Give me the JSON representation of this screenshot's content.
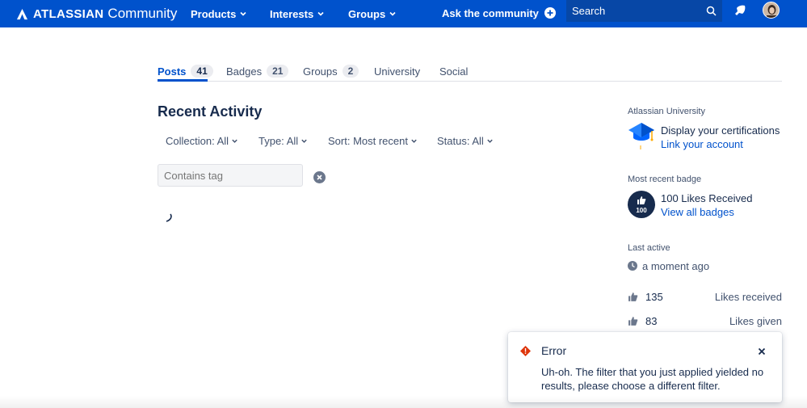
{
  "nav": {
    "brand_bold": "ATLASSIAN",
    "brand_light": "Community",
    "items": [
      {
        "label": "Products"
      },
      {
        "label": "Interests"
      },
      {
        "label": "Groups"
      }
    ],
    "ask_label": "Ask the community",
    "search_placeholder": "Search"
  },
  "tabs": [
    {
      "label": "Posts",
      "count": "41"
    },
    {
      "label": "Badges",
      "count": "21"
    },
    {
      "label": "Groups",
      "count": "2"
    },
    {
      "label": "University"
    },
    {
      "label": "Social"
    }
  ],
  "activity": {
    "title": "Recent Activity",
    "filters": [
      "Collection: All",
      "Type: All",
      "Sort: Most recent",
      "Status: All"
    ],
    "tag_placeholder": "Contains tag"
  },
  "sidebar": {
    "university_label": "Atlassian University",
    "university_main": "Display your certifications",
    "university_link": "Link your account",
    "badge_label": "Most recent badge",
    "badge_main": "100 Likes Received",
    "badge_link": "View all badges",
    "badge_number": "100",
    "last_active_label": "Last active",
    "last_active_value": "a moment ago",
    "stats": [
      {
        "num": "135",
        "label": "Likes received"
      },
      {
        "num": "83",
        "label": "Likes given"
      }
    ]
  },
  "toast": {
    "title": "Error",
    "message": "Uh-oh. The filter that you just applied yielded no results, please choose a different filter."
  },
  "colors": {
    "nav_bg": "#0052cc",
    "link": "#0052cc",
    "error": "#de350b"
  }
}
